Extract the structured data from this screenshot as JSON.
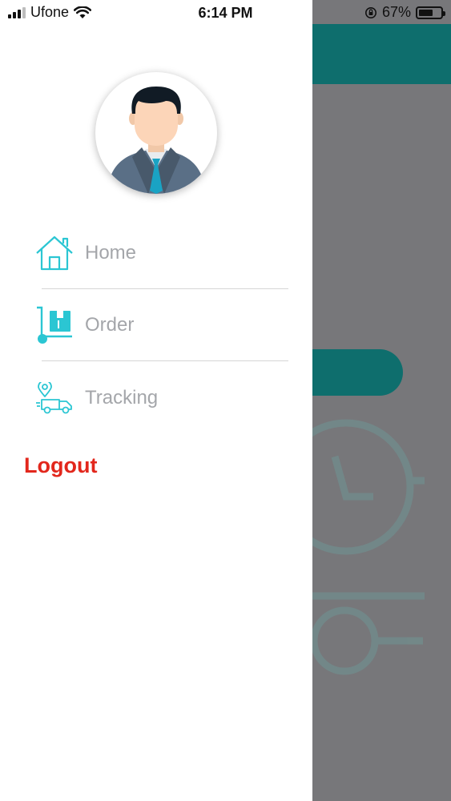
{
  "status_bar": {
    "carrier": "Ufone",
    "time": "6:14 PM",
    "battery_percent": "67%",
    "battery_level": 0.67,
    "icons": [
      "signal-icon",
      "wifi-icon",
      "orientation-lock-icon",
      "battery-icon"
    ]
  },
  "drawer": {
    "avatar": "user-avatar",
    "menu": [
      {
        "label": "Home",
        "icon": "home-icon"
      },
      {
        "label": "Order",
        "icon": "order-cart-icon"
      },
      {
        "label": "Tracking",
        "icon": "tracking-truck-icon"
      }
    ],
    "logout_label": "Logout"
  },
  "colors": {
    "accent": "#2bc6d3",
    "header_teal": "#0e6e6d",
    "logout_red": "#e2271c",
    "label_gray": "#a4a6aa",
    "overlay_gray": "#77777a"
  }
}
